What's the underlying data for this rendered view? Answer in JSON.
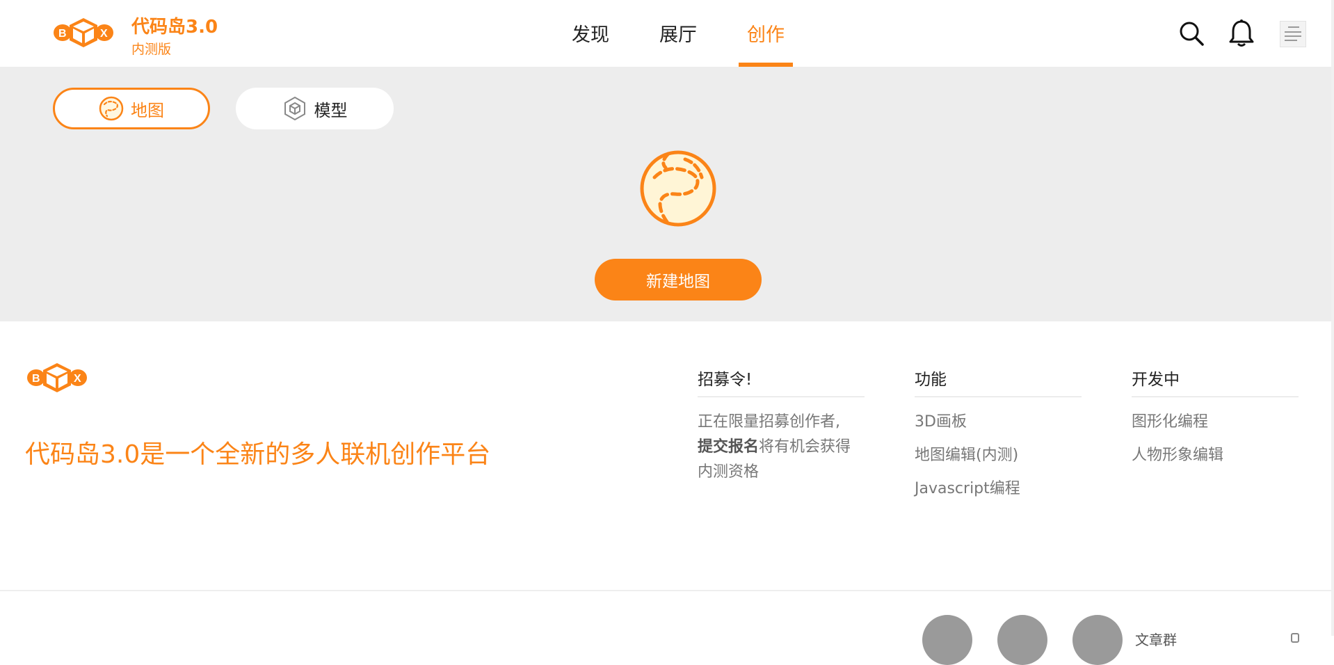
{
  "brand": {
    "title": "代码岛3.0",
    "subtitle": "内测版",
    "logo_letters": [
      "B",
      "X"
    ],
    "accent_color": "#fb8417"
  },
  "nav": {
    "items": [
      {
        "label": "发现",
        "active": false
      },
      {
        "label": "展厅",
        "active": false
      },
      {
        "label": "创作",
        "active": true
      }
    ]
  },
  "header_icons": [
    "search-icon",
    "bell-icon",
    "avatar"
  ],
  "workspace": {
    "tabs": [
      {
        "label": "地图",
        "icon": "map-icon",
        "selected": true
      },
      {
        "label": "模型",
        "icon": "cube-icon",
        "selected": false
      }
    ],
    "center_icon": "map-icon",
    "new_button": "新建地图",
    "background": "#ededed"
  },
  "footer": {
    "tagline": "代码岛3.0是一个全新的多人联机创作平台",
    "columns": [
      {
        "title": "招募令!",
        "text_before": "正在限量招募创作者,",
        "text_bold": "提交报名",
        "text_after": "将有机会获得内测资格"
      },
      {
        "title": "功能",
        "items": [
          "3D画板",
          "地图编辑(内测)",
          "Javascript编程"
        ]
      },
      {
        "title": "开发中",
        "items": [
          "图形化编程",
          "人物形象编辑"
        ]
      }
    ],
    "bottom_stub_text": "文章群"
  }
}
